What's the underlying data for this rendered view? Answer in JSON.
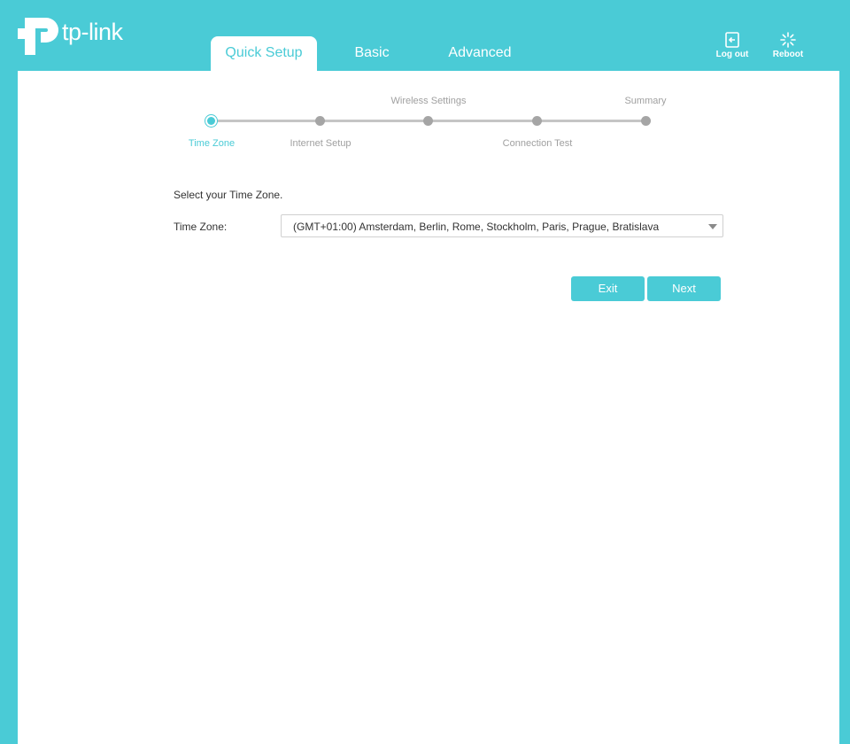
{
  "brand": {
    "logo_text": "tp-link"
  },
  "tabs": [
    {
      "label": "Quick Setup",
      "active": true
    },
    {
      "label": "Basic",
      "active": false
    },
    {
      "label": "Advanced",
      "active": false
    }
  ],
  "top_actions": {
    "logout_label": "Log out",
    "reboot_label": "Reboot"
  },
  "steps": [
    {
      "label": "Time Zone",
      "active": true
    },
    {
      "label": "Internet Setup",
      "active": false
    },
    {
      "label": "Wireless Settings",
      "active": false
    },
    {
      "label": "Connection Test",
      "active": false
    },
    {
      "label": "Summary",
      "active": false
    }
  ],
  "form": {
    "instruction": "Select your Time Zone.",
    "timezone_label": "Time Zone:",
    "timezone_value": "(GMT+01:00) Amsterdam, Berlin, Rome, Stockholm, Paris, Prague, Bratislava"
  },
  "buttons": {
    "exit_label": "Exit",
    "next_label": "Next"
  },
  "colors": {
    "accent": "#4acbd6",
    "inactive_dot": "#a5a5a5",
    "track": "#c5c5c5"
  }
}
